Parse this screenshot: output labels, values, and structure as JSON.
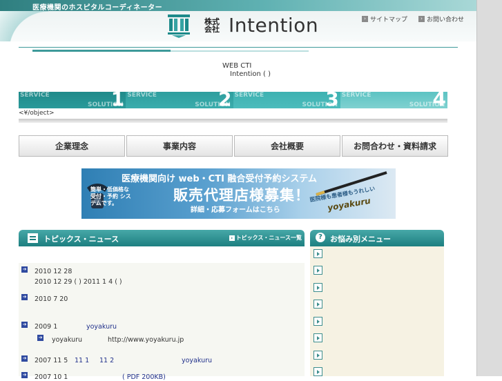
{
  "header": {
    "tagline": "医療機関のホスピタルコーディネーター",
    "logo_kabu": "株式会社",
    "logo_name": "Intention",
    "links": [
      "サイトマップ",
      "お問い合わせ"
    ]
  },
  "intro": {
    "line1": "WEB CTI",
    "line2": "Intention (      )"
  },
  "service_banner": {
    "items": [
      {
        "top": "SERVICE",
        "bottom": "SOLUTION",
        "num": "1"
      },
      {
        "top": "SERVICE",
        "bottom": "SOLUTION",
        "num": "2"
      },
      {
        "top": "SERVICE",
        "bottom": "SOLUTION",
        "num": "3"
      },
      {
        "top": "SERVICE",
        "bottom": "SOLUTION",
        "num": "4"
      }
    ],
    "object_text": "<¥/object>"
  },
  "nav": {
    "items": [
      "企業理念",
      "事業内容",
      "会社概要",
      "お問合わせ・資料請求"
    ]
  },
  "ad": {
    "title": "医療機関向け web・CTI 融合受付予約システム",
    "main": "販売代理店様募集！",
    "sub": "詳細・応募フォームはこちら",
    "left": "簡単・低価格な 受付・予約 システムです。",
    "right": "医院様も患者様もうれしい",
    "brand": "yoyakuru"
  },
  "topics": {
    "title": "トピックス・ニュース",
    "all_link": "トピックス・ニュース一覧",
    "items": [
      {
        "line1": "2010 12 28",
        "line2": "2010 12 29 ( ) 2011 1 4 ( )"
      },
      {
        "line1": "2010 7 20"
      },
      {
        "date": "2009 1",
        "link": "yoyakuru",
        "sub_label": "yoyakuru",
        "sub_url": "http://www.yoyakuru.jp"
      },
      {
        "date": "2007 11 5",
        "link_a": "11 1",
        "link_b": "11 2",
        "link_c": "yoyakuru"
      },
      {
        "date": "2007 10 1",
        "link": "( PDF  200KB)"
      }
    ]
  },
  "concern_menu": {
    "title": "お悩み別メニュー",
    "item_count": 8
  },
  "colors": {
    "teal_dark": "#1d7f80",
    "teal_light": "#47a8a8",
    "link_blue": "#1f2f8a"
  }
}
